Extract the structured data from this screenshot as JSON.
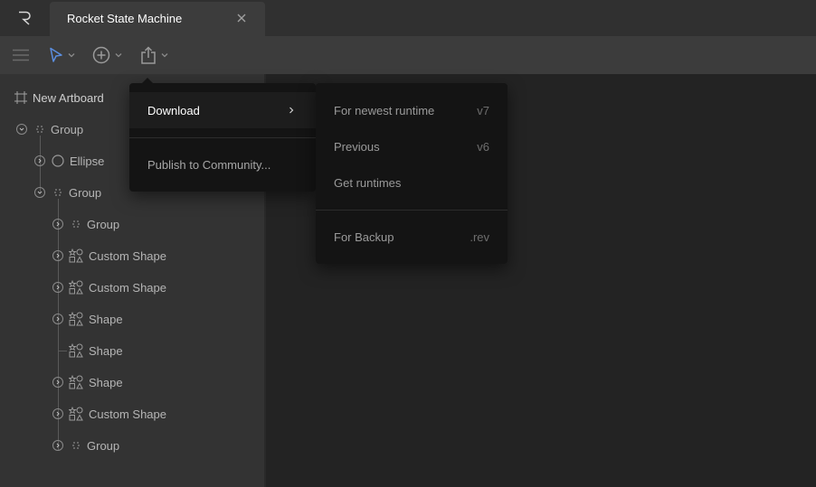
{
  "app": {
    "tab_title": "Rocket State Machine"
  },
  "sidebar": {
    "new_artboard_label": "New Artboard",
    "tree": [
      {
        "label": "Group",
        "icon": "group-icon"
      },
      {
        "label": "Ellipse",
        "icon": "ellipse-icon"
      },
      {
        "label": "Group",
        "icon": "group-icon"
      },
      {
        "label": "Group",
        "icon": "group-icon"
      },
      {
        "label": "Custom Shape",
        "icon": "shape-icon"
      },
      {
        "label": "Custom Shape",
        "icon": "shape-icon"
      },
      {
        "label": "Shape",
        "icon": "shape-icon"
      },
      {
        "label": "Shape",
        "icon": "shape-icon"
      },
      {
        "label": "Shape",
        "icon": "shape-icon"
      },
      {
        "label": "Custom Shape",
        "icon": "shape-icon"
      },
      {
        "label": "Group",
        "icon": "group-icon"
      }
    ]
  },
  "export_menu": {
    "download_label": "Download",
    "publish_label": "Publish to Community..."
  },
  "download_submenu": {
    "items": [
      {
        "label": "For newest runtime",
        "hint": "v7"
      },
      {
        "label": "Previous",
        "hint": "v6"
      },
      {
        "label": "Get runtimes",
        "hint": ""
      },
      {
        "label": "For Backup",
        "hint": ".rev"
      }
    ]
  },
  "colors": {
    "accent": "#5b8ee0",
    "menu_bg": "#141414",
    "sidebar_bg": "#333333",
    "stage_bg": "#232323"
  }
}
